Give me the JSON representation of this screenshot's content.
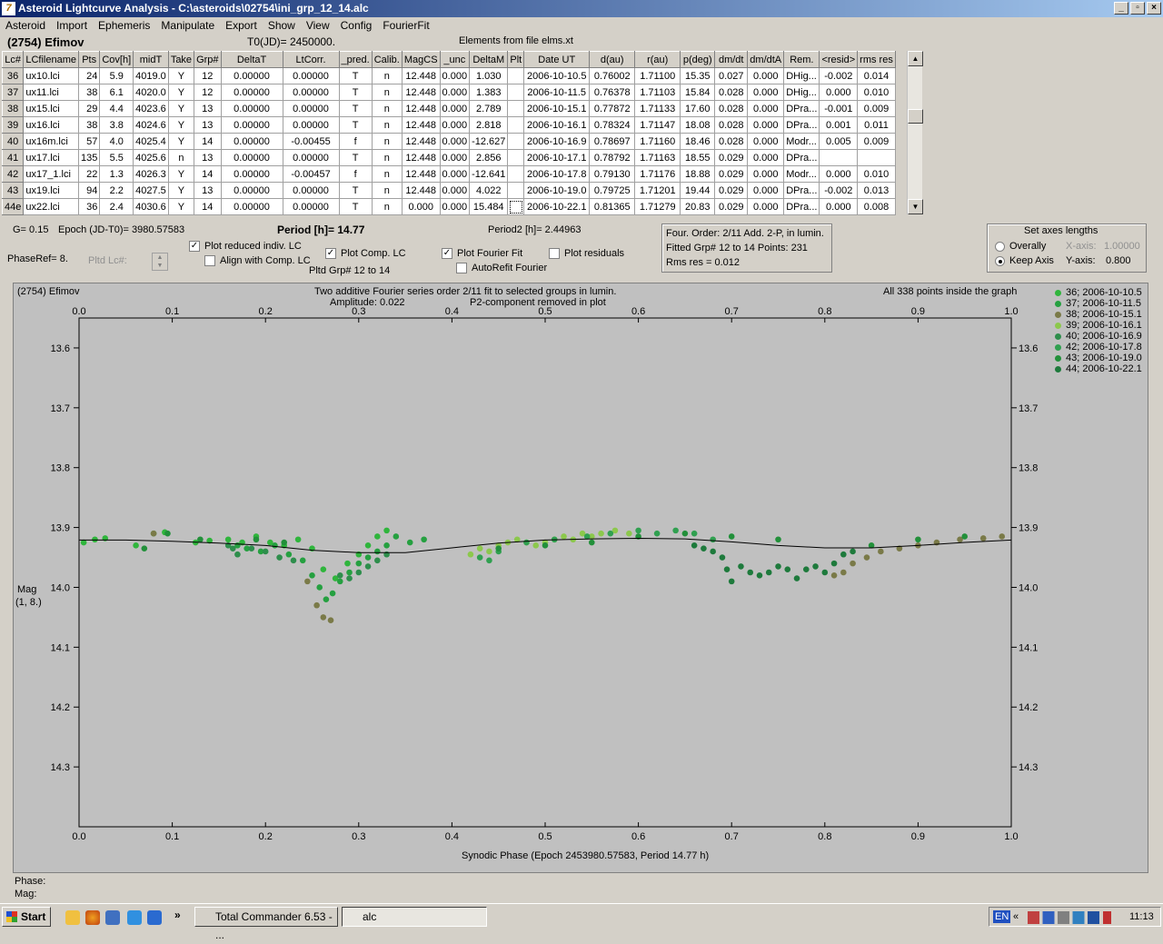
{
  "window": {
    "title": "Asteroid Lightcurve Analysis - C:\\asteroids\\02754\\ini_grp_12_14.alc"
  },
  "menu": [
    "Asteroid",
    "Import",
    "Ephemeris",
    "Manipulate",
    "Export",
    "Show",
    "View",
    "Config",
    "FourierFit"
  ],
  "header": {
    "object": "(2754) Efimov",
    "t0": "T0(JD)= 2450000.",
    "elements": "Elements from file elms.xt"
  },
  "table": {
    "columns": [
      "Lc#",
      "LCfilename",
      "Pts",
      "Cov[h]",
      "midT",
      "Take",
      "Grp#",
      "DeltaT",
      "LtCorr.",
      "_pred.",
      "Calib.",
      "MagCS",
      "_unc",
      "DeltaM",
      "Plt",
      "Date UT",
      "d(au)",
      "r(au)",
      "p(deg)",
      "dm/dt",
      "dm/dtA",
      "Rem.",
      "<resid>",
      "rms res"
    ],
    "rows": [
      [
        "36",
        "ux10.lci",
        "24",
        "5.9",
        "4019.0",
        "Y",
        "12",
        "0.00000",
        "0.00000",
        "T",
        "n",
        "12.448",
        "0.000",
        "1.030",
        "",
        "2006-10-10.5",
        "0.76002",
        "1.71100",
        "15.35",
        "0.027",
        "0.000",
        "DHig...",
        "-0.002",
        "0.014"
      ],
      [
        "37",
        "ux11.lci",
        "38",
        "6.1",
        "4020.0",
        "Y",
        "12",
        "0.00000",
        "0.00000",
        "T",
        "n",
        "12.448",
        "0.000",
        "1.383",
        "",
        "2006-10-11.5",
        "0.76378",
        "1.71103",
        "15.84",
        "0.028",
        "0.000",
        "DHig...",
        "0.000",
        "0.010"
      ],
      [
        "38",
        "ux15.lci",
        "29",
        "4.4",
        "4023.6",
        "Y",
        "13",
        "0.00000",
        "0.00000",
        "T",
        "n",
        "12.448",
        "0.000",
        "2.789",
        "",
        "2006-10-15.1",
        "0.77872",
        "1.71133",
        "17.60",
        "0.028",
        "0.000",
        "DPra...",
        "-0.001",
        "0.009"
      ],
      [
        "39",
        "ux16.lci",
        "38",
        "3.8",
        "4024.6",
        "Y",
        "13",
        "0.00000",
        "0.00000",
        "T",
        "n",
        "12.448",
        "0.000",
        "2.818",
        "",
        "2006-10-16.1",
        "0.78324",
        "1.71147",
        "18.08",
        "0.028",
        "0.000",
        "DPra...",
        "0.001",
        "0.011"
      ],
      [
        "40",
        "ux16m.lci",
        "57",
        "4.0",
        "4025.4",
        "Y",
        "14",
        "0.00000",
        "-0.00455",
        "f",
        "n",
        "12.448",
        "0.000",
        "-12.627",
        "",
        "2006-10-16.9",
        "0.78697",
        "1.71160",
        "18.46",
        "0.028",
        "0.000",
        "Modr...",
        "0.005",
        "0.009"
      ],
      [
        "41",
        "ux17.lci",
        "135",
        "5.5",
        "4025.6",
        "n",
        "13",
        "0.00000",
        "0.00000",
        "T",
        "n",
        "12.448",
        "0.000",
        "2.856",
        "",
        "2006-10-17.1",
        "0.78792",
        "1.71163",
        "18.55",
        "0.029",
        "0.000",
        "DPra...",
        "",
        ""
      ],
      [
        "42",
        "ux17_1.lci",
        "22",
        "1.3",
        "4026.3",
        "Y",
        "14",
        "0.00000",
        "-0.00457",
        "f",
        "n",
        "12.448",
        "0.000",
        "-12.641",
        "",
        "2006-10-17.8",
        "0.79130",
        "1.71176",
        "18.88",
        "0.029",
        "0.000",
        "Modr...",
        "0.000",
        "0.010"
      ],
      [
        "43",
        "ux19.lci",
        "94",
        "2.2",
        "4027.5",
        "Y",
        "13",
        "0.00000",
        "0.00000",
        "T",
        "n",
        "12.448",
        "0.000",
        "4.022",
        "",
        "2006-10-19.0",
        "0.79725",
        "1.71201",
        "19.44",
        "0.029",
        "0.000",
        "DPra...",
        "-0.002",
        "0.013"
      ],
      [
        "44e",
        "ux22.lci",
        "36",
        "2.4",
        "4030.6",
        "Y",
        "14",
        "0.00000",
        "0.00000",
        "T",
        "n",
        "0.000",
        "0.000",
        "15.484",
        "",
        "2006-10-22.1",
        "0.81365",
        "1.71279",
        "20.83",
        "0.029",
        "0.000",
        "DPra...",
        "0.000",
        "0.008"
      ]
    ]
  },
  "controls": {
    "g": "G= 0.15",
    "epoch": "Epoch (JD-T0)= 3980.57583",
    "period": "Period [h]= 14.77",
    "period2": "Period2 [h]= 2.44963",
    "phaseref": "PhaseRef= 8.",
    "pltdlc": "Pltd Lc#:",
    "plot_reduced": "Plot reduced indiv. LC",
    "align_comp": "Align with Comp. LC",
    "plot_comp": "Plot Comp. LC",
    "pltd_grp": "Pltd Grp#  12 to   14",
    "plot_fourier": "Plot Fourier Fit",
    "autorefit": "AutoRefit Fourier",
    "plot_resid": "Plot residuals",
    "fourier_order": "Four. Order:  2/11     Add. 2-P, in lumin.",
    "fitted": "Fitted Grp# 12 to 14 Points: 231",
    "rms": "Rms res      = 0.012",
    "axes_title": "Set axes lengths",
    "overally": "Overally",
    "keep_axis": "Keep Axis",
    "xaxis_label": "X-axis:",
    "xaxis_val": "1.00000",
    "yaxis_label": "Y-axis:",
    "yaxis_val": "0.800"
  },
  "plot": {
    "object": "(2754) Efimov",
    "caption1": "Two additive Fourier series order 2/11 fit to selected groups in lumin.",
    "amplitude": "Amplitude: 0.022",
    "p2": "P2-component removed in plot",
    "inside": "All 338 points inside the graph",
    "ylabel1": "Mag",
    "ylabel2": "(1, 8.)",
    "xlabel": "Synodic Phase (Epoch 2453980.57583, Period 14.77 h)",
    "phase_readout": "Phase:",
    "mag_readout": "Mag:"
  },
  "legend": [
    {
      "label": "36; 2006-10-10.5",
      "color": "#2fb53c"
    },
    {
      "label": "37; 2006-10-11.5",
      "color": "#25a040"
    },
    {
      "label": "38; 2006-10-15.1",
      "color": "#7a7a48"
    },
    {
      "label": "39; 2006-10-16.1",
      "color": "#8cc84c"
    },
    {
      "label": "40; 2006-10-16.9",
      "color": "#2e8e4c"
    },
    {
      "label": "42; 2006-10-17.8",
      "color": "#30a050"
    },
    {
      "label": "43; 2006-10-19.0",
      "color": "#22903a"
    },
    {
      "label": "44; 2006-10-22.1",
      "color": "#1e7a3c"
    }
  ],
  "chart_data": {
    "type": "scatter",
    "xlim": [
      0,
      1
    ],
    "ylim": [
      14.4,
      13.55
    ],
    "xticks": [
      0.0,
      0.1,
      0.2,
      0.3,
      0.4,
      0.5,
      0.6,
      0.7,
      0.8,
      0.9,
      1.0
    ],
    "xtick_labels": [
      "0.0",
      "0.1",
      "0.2",
      "0.3",
      "0.4",
      "0.5",
      "0.6",
      "0.7",
      "0.8",
      "0.9",
      "1.0"
    ],
    "yticks": [
      13.6,
      13.7,
      13.8,
      13.9,
      14.0,
      14.1,
      14.2,
      14.3
    ],
    "ytick_labels": [
      "13.6",
      "13.7",
      "13.8",
      "13.9",
      "14.0",
      "14.1",
      "14.2",
      "14.3"
    ],
    "fit": {
      "x": [
        0,
        0.05,
        0.1,
        0.15,
        0.2,
        0.25,
        0.3,
        0.35,
        0.4,
        0.45,
        0.5,
        0.55,
        0.6,
        0.65,
        0.7,
        0.75,
        0.8,
        0.85,
        0.9,
        0.95,
        1.0
      ],
      "y": [
        13.921,
        13.921,
        13.923,
        13.926,
        13.93,
        13.938,
        13.942,
        13.942,
        13.934,
        13.926,
        13.921,
        13.919,
        13.918,
        13.919,
        13.924,
        13.93,
        13.934,
        13.934,
        13.93,
        13.925,
        13.921
      ]
    },
    "series": [
      {
        "color": "#2fb53c",
        "points": [
          [
            0.005,
            13.925
          ],
          [
            0.017,
            13.92
          ],
          [
            0.028,
            13.918
          ],
          [
            0.061,
            13.93
          ],
          [
            0.08,
            13.91
          ],
          [
            0.092,
            13.908
          ],
          [
            0.125,
            13.925
          ],
          [
            0.14,
            13.922
          ],
          [
            0.16,
            13.92
          ],
          [
            0.175,
            13.925
          ],
          [
            0.19,
            13.915
          ],
          [
            0.205,
            13.925
          ],
          [
            0.22,
            13.93
          ],
          [
            0.235,
            13.92
          ],
          [
            0.25,
            13.935
          ],
          [
            0.262,
            13.97
          ],
          [
            0.275,
            13.985
          ],
          [
            0.288,
            13.96
          ],
          [
            0.3,
            13.945
          ],
          [
            0.31,
            13.93
          ],
          [
            0.32,
            13.915
          ],
          [
            0.33,
            13.905
          ]
        ]
      },
      {
        "color": "#25a040",
        "points": [
          [
            0.17,
            13.93
          ],
          [
            0.18,
            13.935
          ],
          [
            0.195,
            13.94
          ],
          [
            0.21,
            13.93
          ],
          [
            0.225,
            13.945
          ],
          [
            0.24,
            13.955
          ],
          [
            0.25,
            13.98
          ],
          [
            0.258,
            14.0
          ],
          [
            0.265,
            14.02
          ],
          [
            0.272,
            14.01
          ],
          [
            0.28,
            13.99
          ],
          [
            0.29,
            13.975
          ],
          [
            0.3,
            13.96
          ],
          [
            0.31,
            13.95
          ],
          [
            0.32,
            13.94
          ],
          [
            0.33,
            13.93
          ],
          [
            0.34,
            13.915
          ],
          [
            0.355,
            13.925
          ],
          [
            0.37,
            13.92
          ]
        ]
      },
      {
        "color": "#7a7a48",
        "points": [
          [
            0.08,
            13.91
          ],
          [
            0.245,
            13.99
          ],
          [
            0.255,
            14.03
          ],
          [
            0.262,
            14.05
          ],
          [
            0.27,
            14.055
          ],
          [
            0.81,
            13.98
          ],
          [
            0.82,
            13.975
          ],
          [
            0.83,
            13.96
          ],
          [
            0.845,
            13.95
          ],
          [
            0.86,
            13.94
          ],
          [
            0.88,
            13.935
          ],
          [
            0.9,
            13.93
          ],
          [
            0.92,
            13.925
          ],
          [
            0.945,
            13.92
          ],
          [
            0.97,
            13.918
          ],
          [
            0.99,
            13.915
          ]
        ]
      },
      {
        "color": "#8cc84c",
        "points": [
          [
            0.42,
            13.945
          ],
          [
            0.43,
            13.935
          ],
          [
            0.44,
            13.94
          ],
          [
            0.45,
            13.93
          ],
          [
            0.46,
            13.925
          ],
          [
            0.47,
            13.92
          ],
          [
            0.48,
            13.925
          ],
          [
            0.49,
            13.93
          ],
          [
            0.5,
            13.925
          ],
          [
            0.51,
            13.92
          ],
          [
            0.52,
            13.915
          ],
          [
            0.53,
            13.92
          ],
          [
            0.54,
            13.91
          ],
          [
            0.55,
            13.915
          ],
          [
            0.56,
            13.91
          ],
          [
            0.575,
            13.905
          ],
          [
            0.59,
            13.91
          ]
        ]
      },
      {
        "color": "#2e8e4c",
        "points": [
          [
            0.16,
            13.93
          ],
          [
            0.165,
            13.935
          ],
          [
            0.17,
            13.945
          ],
          [
            0.185,
            13.935
          ],
          [
            0.2,
            13.94
          ],
          [
            0.215,
            13.95
          ],
          [
            0.23,
            13.955
          ],
          [
            0.28,
            13.98
          ],
          [
            0.29,
            13.985
          ],
          [
            0.3,
            13.975
          ],
          [
            0.31,
            13.965
          ],
          [
            0.32,
            13.955
          ],
          [
            0.33,
            13.945
          ]
        ]
      },
      {
        "color": "#30a050",
        "points": [
          [
            0.43,
            13.95
          ],
          [
            0.44,
            13.955
          ],
          [
            0.45,
            13.94
          ],
          [
            0.48,
            13.925
          ],
          [
            0.51,
            13.92
          ],
          [
            0.545,
            13.915
          ],
          [
            0.57,
            13.91
          ],
          [
            0.6,
            13.905
          ],
          [
            0.62,
            13.91
          ],
          [
            0.64,
            13.905
          ],
          [
            0.66,
            13.91
          ],
          [
            0.68,
            13.92
          ]
        ]
      },
      {
        "color": "#22903a",
        "points": [
          [
            0.07,
            13.935
          ],
          [
            0.095,
            13.91
          ],
          [
            0.13,
            13.92
          ],
          [
            0.19,
            13.92
          ],
          [
            0.22,
            13.925
          ],
          [
            0.45,
            13.935
          ],
          [
            0.5,
            13.93
          ],
          [
            0.55,
            13.925
          ],
          [
            0.6,
            13.915
          ],
          [
            0.65,
            13.91
          ],
          [
            0.7,
            13.915
          ],
          [
            0.75,
            13.92
          ],
          [
            0.85,
            13.93
          ],
          [
            0.9,
            13.92
          ],
          [
            0.95,
            13.915
          ]
        ]
      },
      {
        "color": "#1e7a3c",
        "points": [
          [
            0.66,
            13.93
          ],
          [
            0.67,
            13.935
          ],
          [
            0.68,
            13.94
          ],
          [
            0.69,
            13.95
          ],
          [
            0.695,
            13.97
          ],
          [
            0.7,
            13.99
          ],
          [
            0.71,
            13.965
          ],
          [
            0.72,
            13.975
          ],
          [
            0.73,
            13.98
          ],
          [
            0.74,
            13.975
          ],
          [
            0.75,
            13.965
          ],
          [
            0.76,
            13.97
          ],
          [
            0.77,
            13.985
          ],
          [
            0.78,
            13.97
          ],
          [
            0.79,
            13.965
          ],
          [
            0.8,
            13.975
          ],
          [
            0.81,
            13.96
          ],
          [
            0.82,
            13.945
          ],
          [
            0.83,
            13.94
          ]
        ]
      }
    ]
  },
  "taskbar": {
    "start": "Start",
    "task1": "Total Commander 6.53 - ...",
    "task2": "alc",
    "lang": "EN",
    "time": "11:13"
  }
}
